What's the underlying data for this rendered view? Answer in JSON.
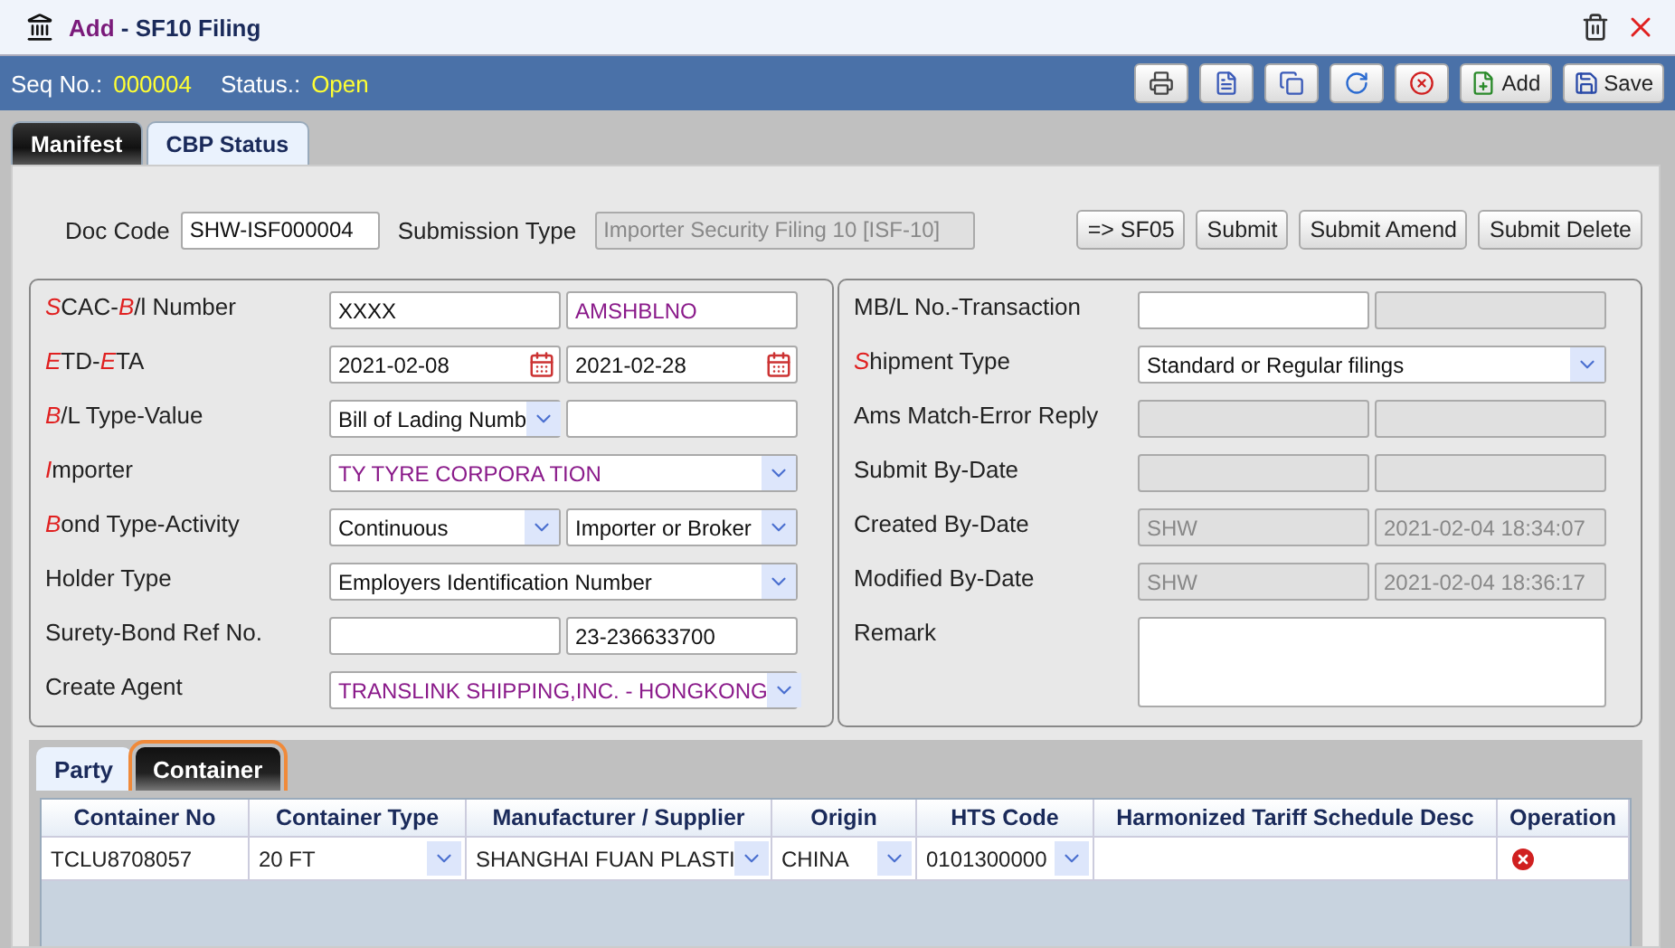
{
  "window": {
    "title_action": "Add",
    "title": "- SF10 Filing"
  },
  "info_bar": {
    "seq_label": "Seq No.:",
    "seq_value": "000004",
    "status_label": "Status.:",
    "status_value": "Open"
  },
  "toolbar": [
    {
      "kind": "print"
    },
    {
      "kind": "document"
    },
    {
      "kind": "copy"
    },
    {
      "kind": "refresh"
    },
    {
      "kind": "cancel"
    },
    {
      "kind": "add",
      "label": "Add"
    },
    {
      "kind": "save",
      "label": "Save"
    }
  ],
  "tabs": [
    {
      "label": "Manifest",
      "selected": true
    },
    {
      "label": "CBP Status",
      "selected": false
    }
  ],
  "doc_row": {
    "doc_code_label": "Doc Code",
    "doc_code": "SHW-ISF000004",
    "submission_label": "Submission Type",
    "submission_type": "Importer Security Filing 10 [ISF-10]",
    "buttons": [
      "=> SF05",
      "Submit",
      "Submit Amend",
      "Submit Delete"
    ]
  },
  "left_fields": [
    {
      "label": [
        {
          "text": "S",
          "required": true
        },
        {
          "text": "CAC-",
          "required": false
        },
        {
          "text": "B",
          "required": true
        },
        {
          "text": "/l Number",
          "required": false
        }
      ],
      "inputs": [
        {
          "kind": "text",
          "value": "XXXX",
          "disabled": false
        },
        {
          "kind": "text",
          "value": "AMSHBLNO",
          "disabled": false,
          "emphasis": true
        }
      ]
    },
    {
      "label": [
        {
          "text": "E",
          "required": true
        },
        {
          "text": "TD-",
          "required": false
        },
        {
          "text": "E",
          "required": true
        },
        {
          "text": "TA",
          "required": false
        }
      ],
      "inputs": [
        {
          "kind": "date",
          "value": "2021-02-08",
          "disabled": false
        },
        {
          "kind": "date",
          "value": "2021-02-28",
          "disabled": false
        }
      ]
    },
    {
      "label": [
        {
          "text": "B",
          "required": true
        },
        {
          "text": "/L Type-Value",
          "required": false
        }
      ],
      "inputs": [
        {
          "kind": "select",
          "value": "Bill of Lading Numb",
          "disabled": false
        },
        {
          "kind": "text",
          "disabled": false
        }
      ]
    },
    {
      "label": [
        {
          "text": "I",
          "required": true
        },
        {
          "text": "mporter",
          "required": false
        }
      ],
      "inputs": [
        {
          "kind": "select",
          "value": "TY TYRE CORPORA TION",
          "disabled": false,
          "emphasis": true
        }
      ]
    },
    {
      "label": [
        {
          "text": "B",
          "required": true
        },
        {
          "text": "ond Type-Activity",
          "required": false
        }
      ],
      "inputs": [
        {
          "kind": "select",
          "value": "Continuous",
          "disabled": false
        },
        {
          "kind": "select",
          "value": "Importer or Broker",
          "disabled": false
        }
      ]
    },
    {
      "label": [
        {
          "text": "Holder Type",
          "required": false
        }
      ],
      "inputs": [
        {
          "kind": "select",
          "value": "Employers Identification Number",
          "disabled": false
        }
      ]
    },
    {
      "label": [
        {
          "text": "Surety-Bond Ref No.",
          "required": false
        }
      ],
      "inputs": [
        {
          "kind": "text",
          "disabled": false
        },
        {
          "kind": "text",
          "value": "23-236633700",
          "disabled": false
        }
      ]
    },
    {
      "label": [
        {
          "text": "Create Agent",
          "required": false
        }
      ],
      "inputs": [
        {
          "kind": "select",
          "value": "TRANSLINK SHIPPING,INC. - HONGKONG",
          "disabled": false,
          "emphasis": true
        }
      ]
    }
  ],
  "right_fields": [
    {
      "label": [
        {
          "text": "MB/L No.-Transaction",
          "required": false
        }
      ],
      "inputs": [
        {
          "kind": "text",
          "disabled": false
        },
        {
          "kind": "text",
          "disabled": true
        }
      ]
    },
    {
      "label": [
        {
          "text": "S",
          "required": true
        },
        {
          "text": "hipment Type",
          "required": false
        }
      ],
      "inputs": [
        {
          "kind": "select",
          "value": "Standard or Regular filings",
          "disabled": false
        }
      ]
    },
    {
      "label": [
        {
          "text": "Ams Match-Error Reply",
          "required": false
        }
      ],
      "inputs": [
        {
          "kind": "text",
          "disabled": true
        },
        {
          "kind": "text",
          "disabled": true
        }
      ]
    },
    {
      "label": [
        {
          "text": "Submit By-Date",
          "required": false
        }
      ],
      "inputs": [
        {
          "kind": "text",
          "disabled": true
        },
        {
          "kind": "text",
          "disabled": true
        }
      ]
    },
    {
      "label": [
        {
          "text": "Created By-Date",
          "required": false
        }
      ],
      "inputs": [
        {
          "kind": "text",
          "value": "SHW",
          "disabled": true
        },
        {
          "kind": "text",
          "value": "2021-02-04 18:34:07",
          "disabled": true
        }
      ]
    },
    {
      "label": [
        {
          "text": "Modified By-Date",
          "required": false
        }
      ],
      "inputs": [
        {
          "kind": "text",
          "value": "SHW",
          "disabled": true
        },
        {
          "kind": "text",
          "value": "2021-02-04 18:36:17",
          "disabled": true
        }
      ]
    },
    {
      "label": [
        {
          "text": "Remark",
          "required": false
        }
      ],
      "inputs": [
        {
          "kind": "textarea",
          "disabled": false
        }
      ]
    }
  ],
  "sub_tabs": [
    {
      "label": "Party",
      "selected": false
    },
    {
      "label": "Container",
      "selected": true
    }
  ],
  "table": {
    "columns": [
      "Container No",
      "Container Type",
      "Manufacturer / Supplier",
      "Origin",
      "HTS Code",
      "Harmonized Tariff Schedule Desc",
      "Operation"
    ],
    "rows": [
      {
        "cells": [
          {
            "kind": "text",
            "value": "TCLU8708057"
          },
          {
            "kind": "select",
            "value": "20 FT"
          },
          {
            "kind": "select",
            "value": "SHANGHAI FUAN PLASTI"
          },
          {
            "kind": "select",
            "value": "CHINA"
          },
          {
            "kind": "select",
            "value": "0101300000"
          },
          {
            "kind": "text"
          },
          {
            "kind": "delete"
          }
        ]
      }
    ]
  }
}
